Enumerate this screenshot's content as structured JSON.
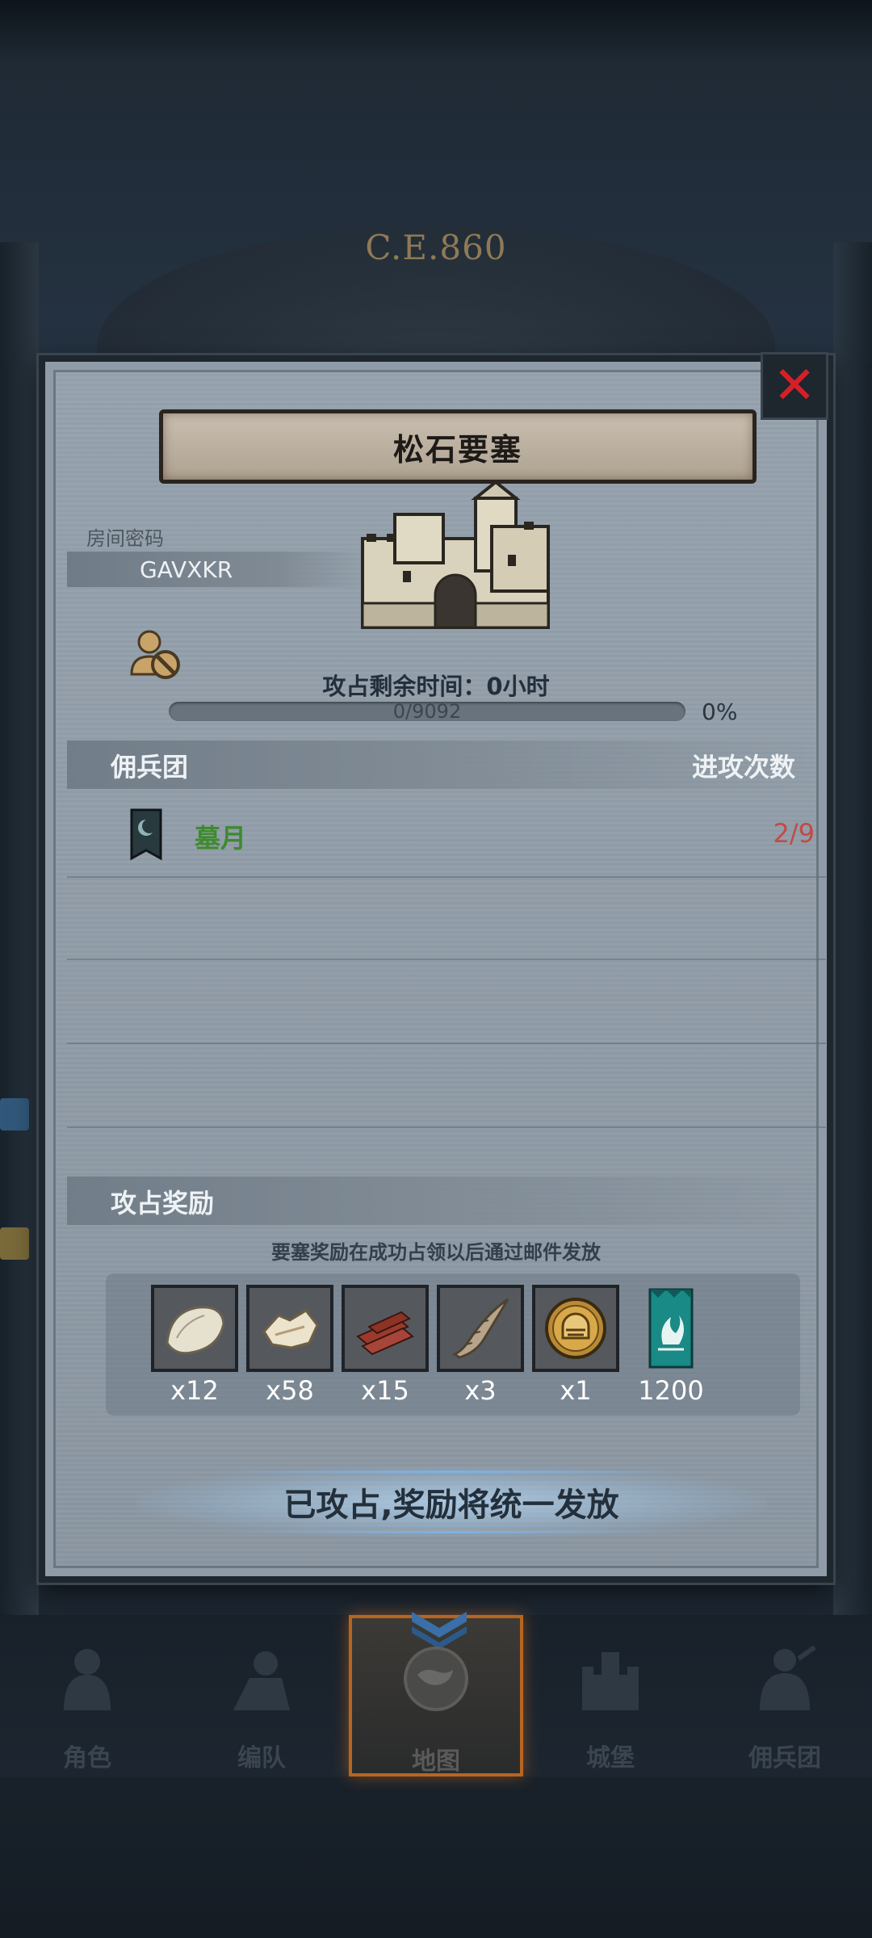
{
  "background": {
    "era_label": "C.E.860"
  },
  "panel": {
    "title": "松石要塞",
    "close_icon": "close-x-icon",
    "room": {
      "label": "房间密码",
      "code": "GAVXKR"
    },
    "timer_text": "攻占剩余时间：0小时",
    "progress": {
      "text": "0/9092",
      "percent_text": "0%",
      "fraction": 0.0
    },
    "mercenary_section": {
      "title": "佣兵团",
      "attacks_header": "进攻次数"
    },
    "guilds": [
      {
        "name": "墓月",
        "attacks": "2/9"
      }
    ],
    "rewards_section": {
      "title": "攻占奖励",
      "note": "要塞奖励在成功占领以后通过邮件发放",
      "items": [
        {
          "icon": "hide-icon",
          "qty": "x12"
        },
        {
          "icon": "leather-icon",
          "qty": "x58"
        },
        {
          "icon": "wood-planks-icon",
          "qty": "x15"
        },
        {
          "icon": "horn-icon",
          "qty": "x3"
        },
        {
          "icon": "helmet-coin-icon",
          "qty": "x1"
        },
        {
          "icon": "guild-banner-icon",
          "qty": "1200"
        }
      ]
    },
    "claim_button": "已攻占,奖励将统一发放"
  },
  "bottom_nav": {
    "items": [
      {
        "label": "角色",
        "icon": "knight-icon",
        "active": false
      },
      {
        "label": "编队",
        "icon": "formation-icon",
        "active": false
      },
      {
        "label": "地图",
        "icon": "map-icon",
        "active": true
      },
      {
        "label": "城堡",
        "icon": "castle-icon",
        "active": false
      },
      {
        "label": "佣兵团",
        "icon": "mercenary-icon",
        "active": false
      }
    ]
  },
  "colors": {
    "accent_orange": "#b8651f",
    "guild_name_green": "#3e8a2e",
    "attack_count_red": "#c24a46",
    "close_red": "#d81f26"
  }
}
